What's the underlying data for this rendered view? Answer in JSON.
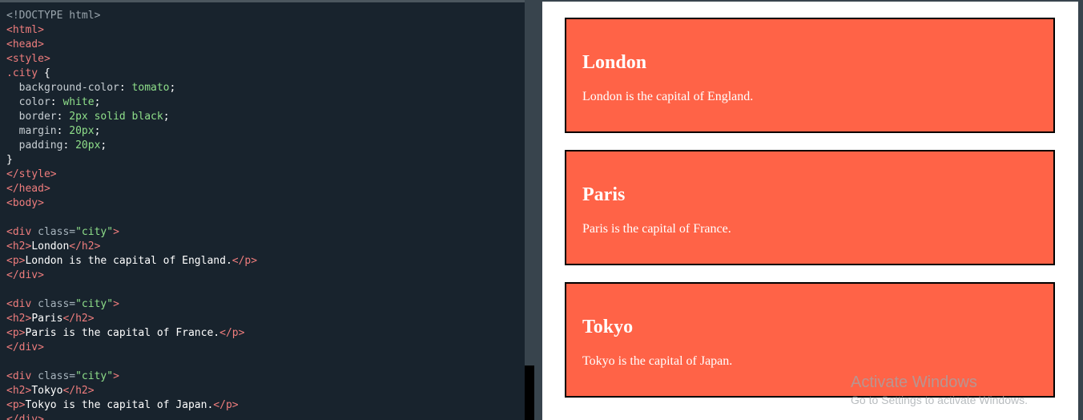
{
  "editor": {
    "lines": [
      [
        [
          "doc",
          "<!DOCTYPE html>"
        ]
      ],
      [
        [
          "tag",
          "<html>"
        ]
      ],
      [
        [
          "tag",
          "<head>"
        ]
      ],
      [
        [
          "tag",
          "<style>"
        ]
      ],
      [
        [
          "sel",
          ".city"
        ],
        [
          "txt",
          " {"
        ]
      ],
      [
        [
          "prop",
          "  background-color"
        ],
        [
          "txt",
          ": "
        ],
        [
          "val",
          "tomato"
        ],
        [
          "txt",
          ";"
        ]
      ],
      [
        [
          "prop",
          "  color"
        ],
        [
          "txt",
          ": "
        ],
        [
          "val",
          "white"
        ],
        [
          "txt",
          ";"
        ]
      ],
      [
        [
          "prop",
          "  border"
        ],
        [
          "txt",
          ": "
        ],
        [
          "val",
          "2px solid black"
        ],
        [
          "txt",
          ";"
        ]
      ],
      [
        [
          "prop",
          "  margin"
        ],
        [
          "txt",
          ": "
        ],
        [
          "val",
          "20px"
        ],
        [
          "txt",
          ";"
        ]
      ],
      [
        [
          "prop",
          "  padding"
        ],
        [
          "txt",
          ": "
        ],
        [
          "val",
          "20px"
        ],
        [
          "txt",
          ";"
        ]
      ],
      [
        [
          "txt",
          "}"
        ]
      ],
      [
        [
          "tag",
          "</style>"
        ]
      ],
      [
        [
          "tag",
          "</head>"
        ]
      ],
      [
        [
          "tag",
          "<body>"
        ]
      ],
      [],
      [
        [
          "tag",
          "<div"
        ],
        [
          "attr",
          " class="
        ],
        [
          "str",
          "\"city\""
        ],
        [
          "tag",
          ">"
        ]
      ],
      [
        [
          "tag",
          "<h2>"
        ],
        [
          "txt",
          "London"
        ],
        [
          "tag",
          "</h2>"
        ]
      ],
      [
        [
          "tag",
          "<p>"
        ],
        [
          "txt",
          "London is the capital of England."
        ],
        [
          "tag",
          "</p>"
        ]
      ],
      [
        [
          "tag",
          "</div>"
        ]
      ],
      [],
      [
        [
          "tag",
          "<div"
        ],
        [
          "attr",
          " class="
        ],
        [
          "str",
          "\"city\""
        ],
        [
          "tag",
          ">"
        ]
      ],
      [
        [
          "tag",
          "<h2>"
        ],
        [
          "txt",
          "Paris"
        ],
        [
          "tag",
          "</h2>"
        ]
      ],
      [
        [
          "tag",
          "<p>"
        ],
        [
          "txt",
          "Paris is the capital of France."
        ],
        [
          "tag",
          "</p>"
        ]
      ],
      [
        [
          "tag",
          "</div>"
        ]
      ],
      [],
      [
        [
          "tag",
          "<div"
        ],
        [
          "attr",
          " class="
        ],
        [
          "str",
          "\"city\""
        ],
        [
          "tag",
          ">"
        ]
      ],
      [
        [
          "tag",
          "<h2>"
        ],
        [
          "txt",
          "Tokyo"
        ],
        [
          "tag",
          "</h2>"
        ]
      ],
      [
        [
          "tag",
          "<p>"
        ],
        [
          "txt",
          "Tokyo is the capital of Japan."
        ],
        [
          "tag",
          "</p>"
        ]
      ],
      [
        [
          "tag",
          "</div>"
        ]
      ]
    ]
  },
  "cities": [
    {
      "name": "London",
      "text": "London is the capital of England."
    },
    {
      "name": "Paris",
      "text": "Paris is the capital of France."
    },
    {
      "name": "Tokyo",
      "text": "Tokyo is the capital of Japan."
    }
  ],
  "watermark": {
    "line1": "Activate Windows",
    "line2": "Go to Settings to activate Windows."
  },
  "colors": {
    "city_background": "#ff6347",
    "editor_background": "#18232d"
  }
}
